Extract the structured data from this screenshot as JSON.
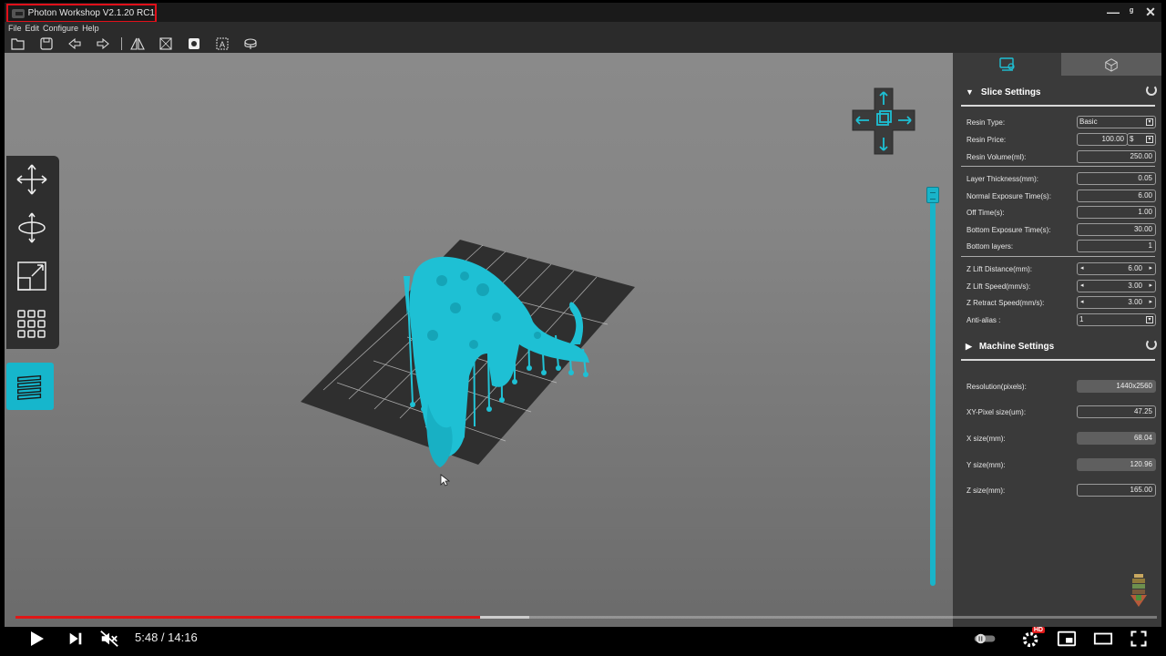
{
  "window": {
    "title": "Photon Workshop V2.1.20 RC1",
    "controls": [
      "—",
      "ᵍ",
      "✕"
    ]
  },
  "menu": [
    "File",
    "Edit",
    "Configure",
    "Help"
  ],
  "toolbar": {
    "icons": [
      "open-file-icon",
      "save-icon",
      "undo-icon",
      "redo-icon",
      "mirror-icon",
      "hollow-icon",
      "punch-hole-icon",
      "text-icon",
      "support-icon"
    ]
  },
  "left_tools": [
    "move-icon",
    "rotate-icon",
    "scale-icon",
    "arrange-icon",
    "layers-icon"
  ],
  "slice_settings": {
    "header": "Slice Settings",
    "rows": [
      {
        "label": "Resin Type:",
        "value": "Basic"
      },
      {
        "label": "Resin Price:",
        "value": "100.00",
        "unit": "$"
      },
      {
        "label": "Resin Volume(ml):",
        "value": "250.00"
      },
      {
        "label": "Layer Thickness(mm):",
        "value": "0.05"
      },
      {
        "label": "Normal Exposure Time(s):",
        "value": "6.00"
      },
      {
        "label": "Off Time(s):",
        "value": "1.00"
      },
      {
        "label": "Bottom Exposure Time(s):",
        "value": "30.00"
      },
      {
        "label": "Bottom layers:",
        "value": "1"
      },
      {
        "label": "Z Lift Distance(mm):",
        "value": "6.00"
      },
      {
        "label": "Z Lift Speed(mm/s):",
        "value": "3.00"
      },
      {
        "label": "Z Retract Speed(mm/s):",
        "value": "3.00"
      },
      {
        "label": "Anti-alias :",
        "value": "1"
      }
    ]
  },
  "machine_settings": {
    "header": "Machine Settings",
    "rows": [
      {
        "label": "Resolution(pixels):",
        "value": "1440x2560"
      },
      {
        "label": "XY-Pixel size(um):",
        "value": "47.25"
      },
      {
        "label": "X size(mm):",
        "value": "68.04"
      },
      {
        "label": "Y size(mm):",
        "value": "120.96"
      },
      {
        "label": "Z size(mm):",
        "value": "165.00"
      }
    ]
  },
  "player": {
    "time": "5:48 / 14:16",
    "progress": 0.407,
    "buffered": 0.45,
    "hd_badge": "HD"
  },
  "colors": {
    "accent": "#16b6cc",
    "progress": "#e01818"
  }
}
